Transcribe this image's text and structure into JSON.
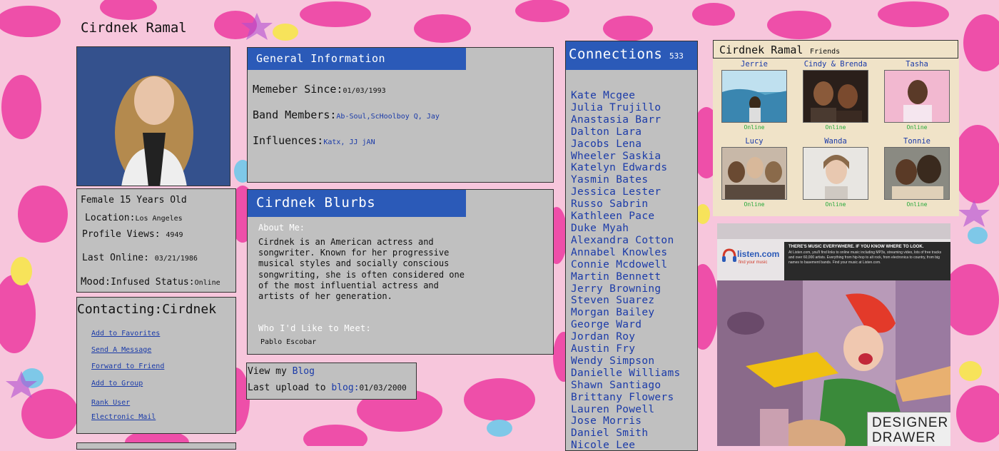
{
  "profile": {
    "name": "Cirdnek Ramal",
    "details": {
      "sex_age": "Female 15 Years Old",
      "location_label": "Location:",
      "location": "Los Angeles",
      "views_label": "Profile Views:",
      "views": "4949",
      "last_online_label": "Last Online:",
      "last_online": "03/21/1986",
      "mood_label": "Mood:",
      "mood": "Infused",
      "status_label": "Status:",
      "status": "Online"
    }
  },
  "contacting": {
    "title": "Contacting:Cirdnek",
    "links": [
      "Add to Favorites",
      "Send A Message",
      "Forward to Friend",
      "Add to Group",
      "Rank User",
      "Electronic Mail"
    ]
  },
  "general": {
    "title": "General Information",
    "member_label": "Memeber Since:",
    "member_value": "01/03/1993",
    "band_label": "Band Members:",
    "band_value": "Ab-Soul,ScHoolboy Q, Jay",
    "influences_label": "Influences:",
    "influences_value": "Katx, JJ jAN"
  },
  "blurbs": {
    "title": "Cirdnek Blurbs",
    "about_label": "About Me:",
    "about_text": "Cirdnek is an American actress and songwriter. Known for her progressive musical styles and socially conscious songwriting, she is often considered one of the most influential actress and artists of her generation.",
    "meet_label": "Who I'd Like to Meet:",
    "meet_text": "Pablo Escobar"
  },
  "blog": {
    "view_prefix": "View my ",
    "blog_link": "Blog",
    "upload_prefix": "Last upload to ",
    "upload_link": "blog:",
    "upload_date": "01/03/2000"
  },
  "connections": {
    "title": "Connections",
    "count": "533",
    "names": [
      "Kate Mcgee",
      "Julia Trujillo",
      "Anastasia Barr",
      "Dalton Lara",
      "Jacobs Lena",
      "Wheeler Saskia",
      "Katelyn Edwards",
      "Yasmin Bates",
      "Jessica Lester",
      "Russo Sabrin",
      "Kathleen Pace",
      "Duke Myah",
      "Alexandra Cotton",
      "Annabel Knowles",
      "Connie Mcdowell",
      "Martin Bennett",
      "Jerry Browning",
      "Steven Suarez",
      "Morgan Bailey",
      "George Ward",
      "Jordan Roy",
      "Austin Fry",
      "Wendy Simpson",
      "Danielle Williams",
      "Shawn Santiago",
      "Brittany Flowers",
      "Lauren Powell",
      "Jose Morris",
      "Daniel Smith",
      "Nicole Lee"
    ]
  },
  "friends": {
    "title": "Cirdnek Ramal",
    "suffix": "Friends",
    "list": [
      {
        "name": "Jerrie",
        "status": "Online"
      },
      {
        "name": "Cindy & Brenda",
        "status": "Online"
      },
      {
        "name": "Tasha",
        "status": "Online"
      },
      {
        "name": "Lucy",
        "status": "Online"
      },
      {
        "name": "Wanda",
        "status": "Online"
      },
      {
        "name": "Tonnie",
        "status": "Online"
      }
    ]
  },
  "ad": {
    "brand": "listen.com",
    "brand_tagline": "find your music",
    "headline": "THERE'S MUSIC EVERYWHERE. IF YOU KNOW WHERE TO LOOK.",
    "body": "At Listen.com, you'll find links to online music including MP3s, streaming video, lots of free tracks and over 60,000 artists. Everything from hip-hop to alt rock, from electronica to country, from big names to basement bands. Find your music at Listen.com.",
    "sign": "DESIGNER DRAWER"
  },
  "colors": {
    "header_blue": "#2b5ab8",
    "panel_gray": "#c0c0c0",
    "link_blue": "#1a3aa8",
    "online_green": "#23a838",
    "friends_bg": "#f0e3c8"
  }
}
